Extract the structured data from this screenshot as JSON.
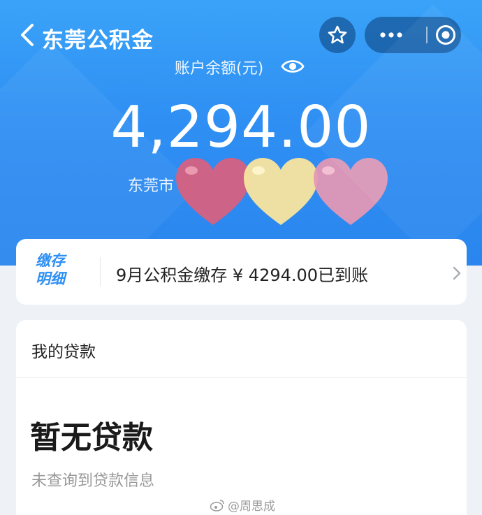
{
  "header": {
    "title": "东莞公积金",
    "back_icon": "chevron-left-icon",
    "favorite_icon": "star-icon",
    "more_icon": "more-dots-icon",
    "close_icon": "target-circle-icon"
  },
  "balance": {
    "label": "账户余额(元)",
    "amount": "4,294.00",
    "city": "东莞市",
    "eye_icon": "eye-icon"
  },
  "notice": {
    "tag_line1": "缴存",
    "tag_line2": "明细",
    "message": "9月公积金缴存 ¥ 4294.00已到账",
    "chevron_icon": "chevron-right-icon"
  },
  "loan": {
    "header": "我的贷款",
    "empty_title": "暂无贷款",
    "empty_sub": "未查询到贷款信息"
  },
  "watermark": "@周思成",
  "colors": {
    "primary_blue": "#2f8ff3",
    "heart_red": "#d9607e",
    "heart_yellow": "#f5e3a0",
    "heart_pink": "#e598b4"
  }
}
